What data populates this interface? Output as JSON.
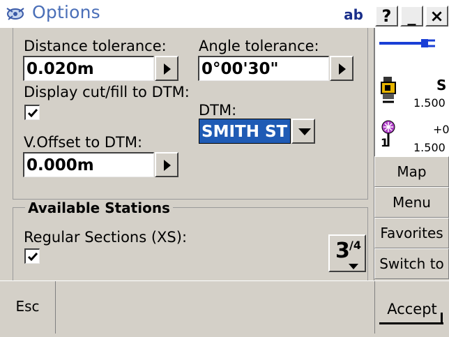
{
  "window": {
    "title": "Options",
    "ab_label": "ab",
    "help_label": "?",
    "minimize_label": "_",
    "close_label": "×"
  },
  "settings": {
    "distance_tolerance": {
      "label": "Distance tolerance:",
      "value": "0.020m"
    },
    "angle_tolerance": {
      "label": "Angle tolerance:",
      "value": "0°00'30\""
    },
    "display_cutfill": {
      "label": "Display cut/fill to DTM:",
      "checked": true
    },
    "dtm": {
      "label": "DTM:",
      "value": "SMITH ST"
    },
    "v_offset": {
      "label": "V.Offset to DTM:",
      "value": "0.000m"
    }
  },
  "stations": {
    "legend": "Available Stations",
    "regular_sections": {
      "label": "Regular Sections (XS):",
      "checked": true
    }
  },
  "pager": {
    "current": "3",
    "total": "/4"
  },
  "status": {
    "instrument_code": "S",
    "instrument_height": "1.500",
    "target_offset": "+0",
    "target_number": "1",
    "target_height": "1.500",
    "connection_color": "#1a3fd6"
  },
  "sidebar": {
    "map_label": "Map",
    "menu_label": "Menu",
    "favorites_label": "Favorites",
    "switch_label": "Switch to"
  },
  "bottom": {
    "esc_label": "Esc",
    "accept_label": "Accept"
  }
}
